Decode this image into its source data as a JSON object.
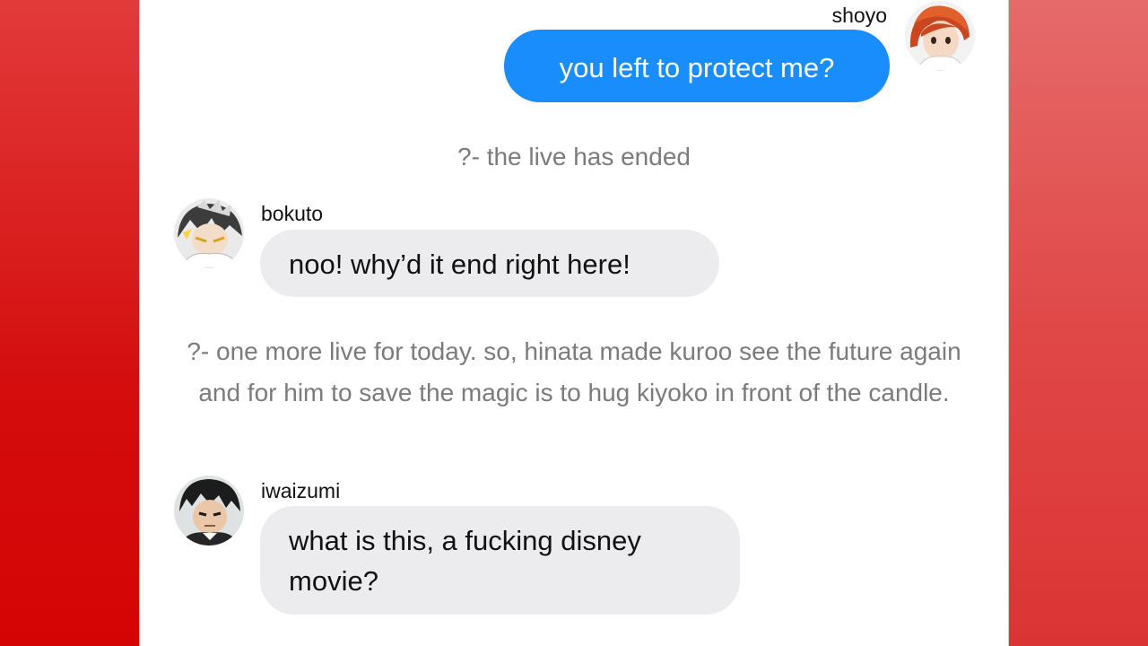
{
  "colors": {
    "outgoing_bubble": "#1a8dfc",
    "incoming_bubble": "#ececee",
    "notice_text": "#7b7b7b",
    "side_panel": "#d40d0d"
  },
  "messages": [
    {
      "sender": "shoyo",
      "avatar": "shoyo-avatar-icon",
      "text": "you left to protect me?",
      "direction": "outgoing"
    },
    {
      "notice": "?- the live has ended"
    },
    {
      "sender": "bokuto",
      "avatar": "bokuto-avatar-icon",
      "text": "noo! why’d it end right here!",
      "direction": "incoming"
    },
    {
      "notice": "?- one more live for today. so, hinata made kuroo see the future again and for him to save the magic is to hug kiyoko in front of the candle."
    },
    {
      "sender": "iwaizumi",
      "avatar": "iwaizumi-avatar-icon",
      "text": "what is this, a fucking disney movie?",
      "direction": "incoming"
    }
  ]
}
